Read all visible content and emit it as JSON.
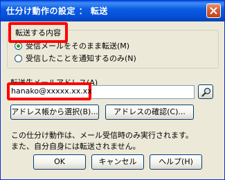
{
  "window": {
    "title": "仕分け動作の設定 ： 転送",
    "title_bar_color": "#0450d7",
    "close_icon": "close-icon"
  },
  "content_group": {
    "legend": "転送する内容",
    "options": [
      {
        "label": "受信メールをそのまま転送(M)",
        "checked": true
      },
      {
        "label": "受信したことを通知するのみ(N)",
        "checked": false
      }
    ]
  },
  "address": {
    "label": "転送先メールアドレス(A)",
    "value": "hanako@xxxxx.xx.xx",
    "search_icon": "magnifier-icon"
  },
  "buttons": {
    "address_book": "アドレス帳から選択(B)...",
    "confirm_address": "アドレスの確認(C)...",
    "ok": "OK",
    "cancel": "キャンセル",
    "help": "ヘルプ(H)"
  },
  "notes": {
    "line1": "この仕分け動作は、メール受信時のみ実行されます。",
    "line2": "また、自分自身には転送されません。"
  },
  "highlight_color": "#ff0000"
}
